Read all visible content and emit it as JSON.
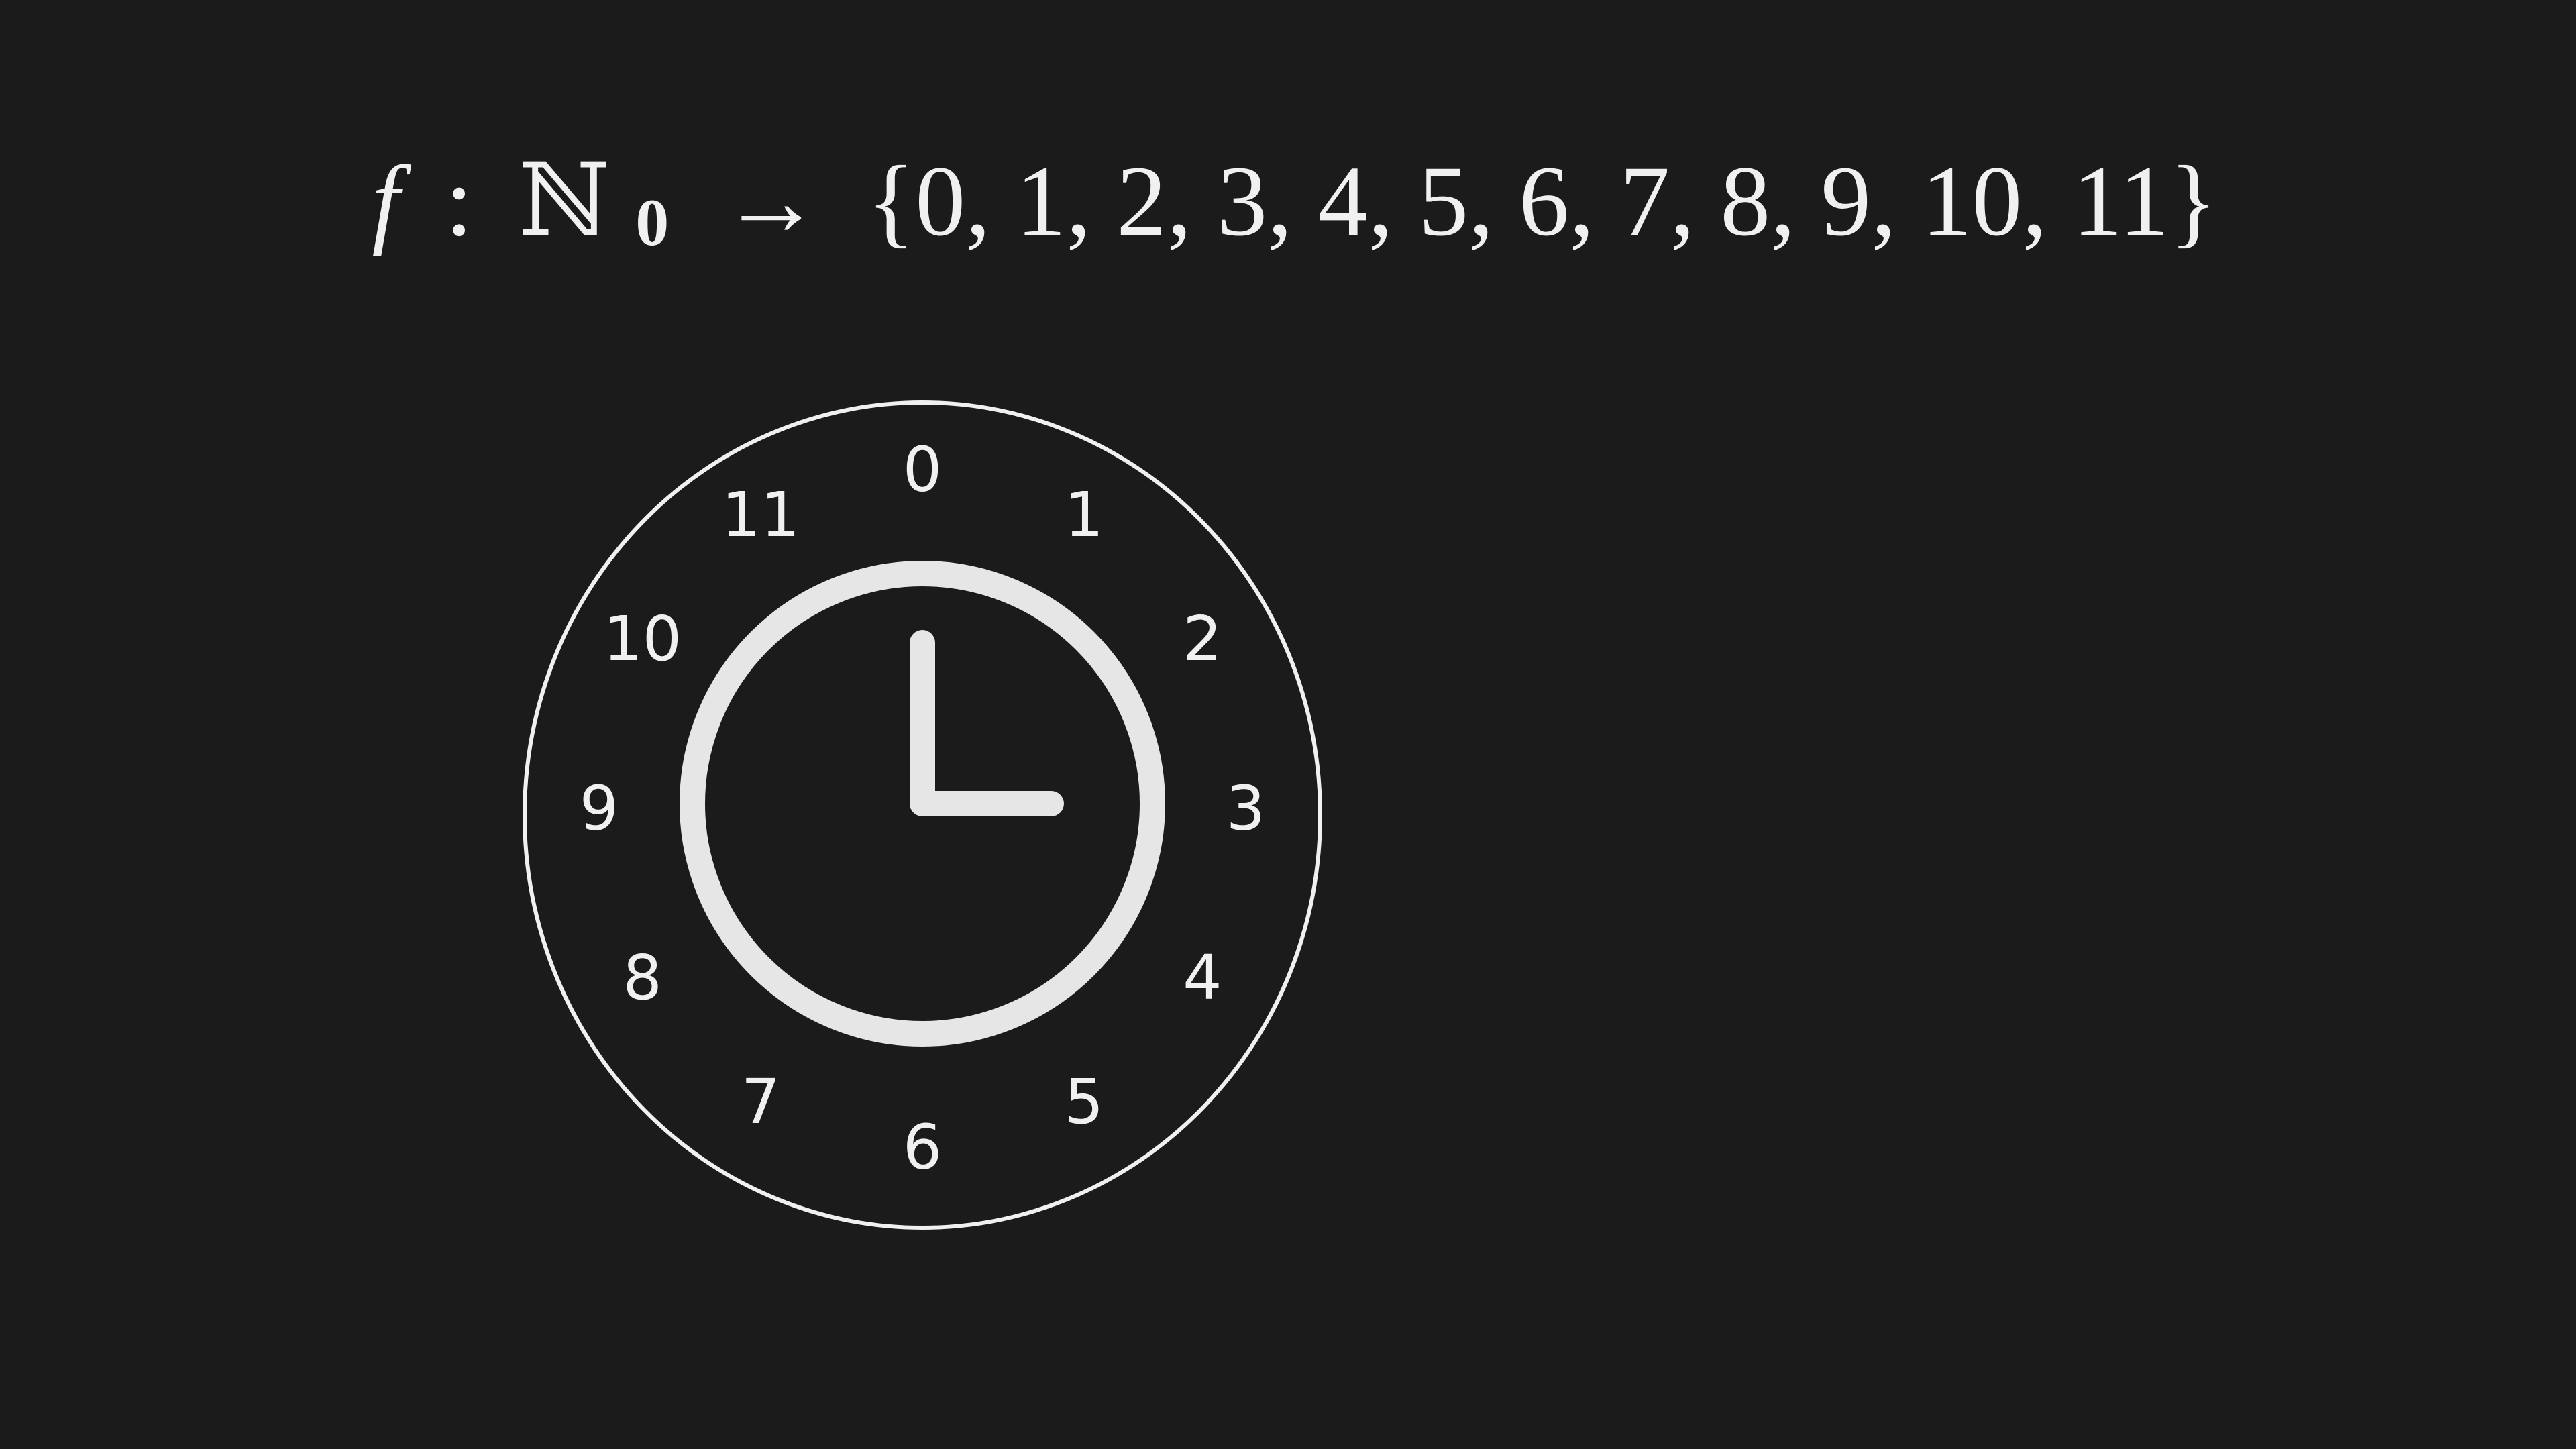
{
  "colors": {
    "background": "#1b1b1b",
    "foreground": "#f0f0f0",
    "clock_icon": "#e6e6e6"
  },
  "formula": {
    "func": "f",
    "colon": ":",
    "domain_set": "ℕ",
    "domain_subscript": "0",
    "arrow": "→",
    "codomain": "{0, 1, 2, 3, 4, 5, 6, 7, 8, 9, 10, 11}"
  },
  "dial": {
    "numbers": [
      "0",
      "1",
      "2",
      "3",
      "4",
      "5",
      "6",
      "7",
      "8",
      "9",
      "10",
      "11"
    ]
  },
  "clock_icon": {
    "name": "clock-icon",
    "hands": "hour at 3, minute at 12"
  }
}
